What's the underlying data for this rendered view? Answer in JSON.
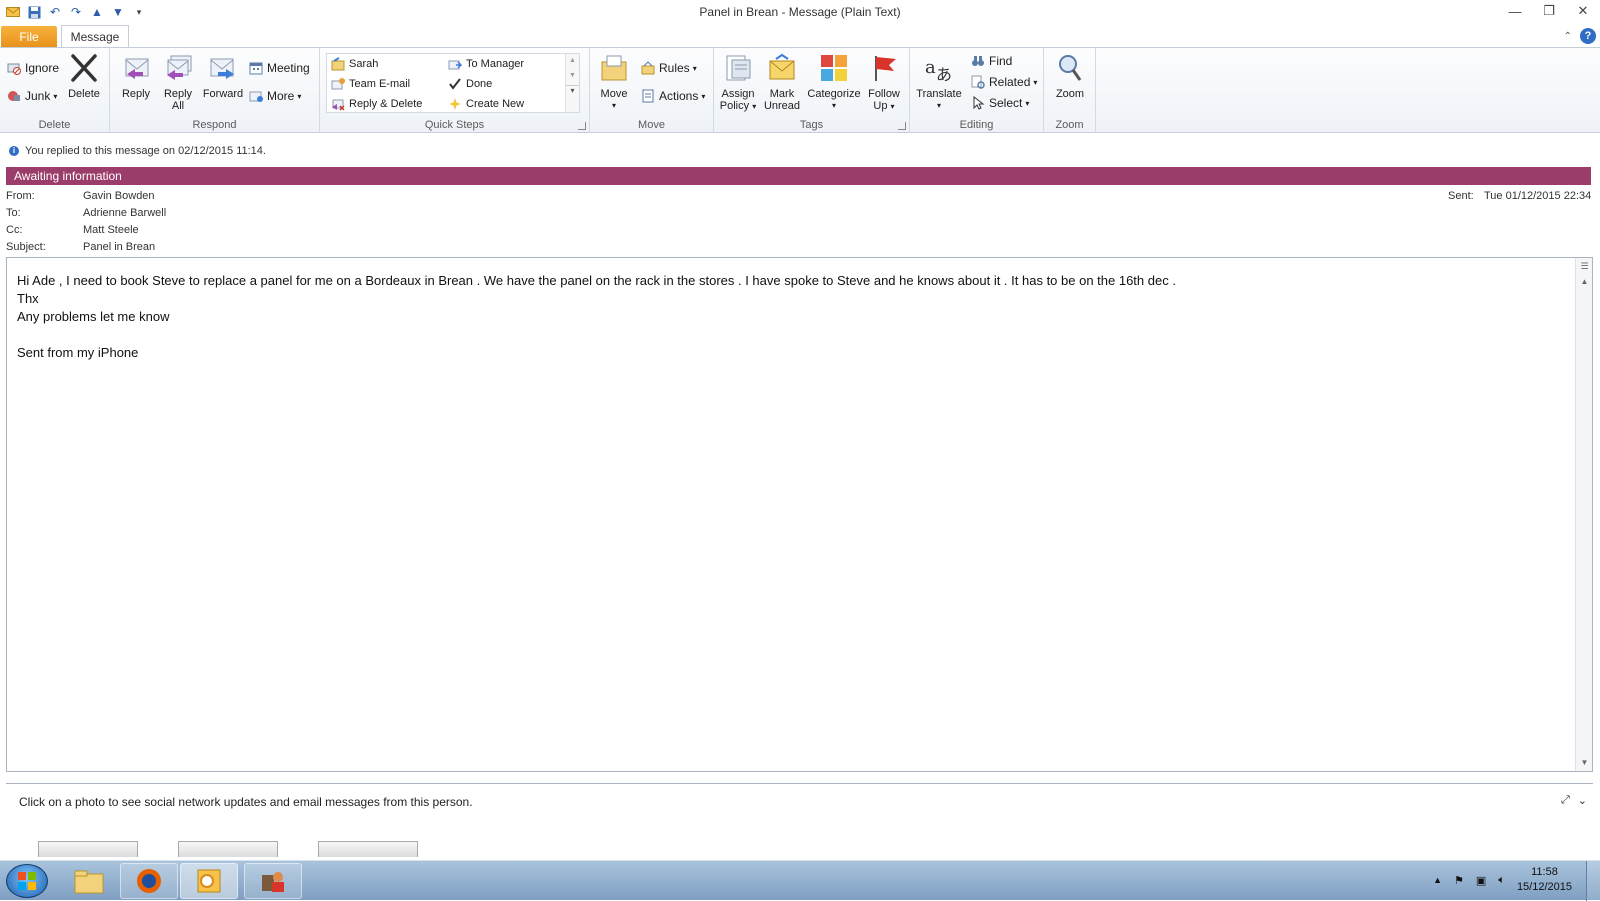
{
  "window": {
    "title": "Panel in Brean  - Message (Plain Text)"
  },
  "tabs": {
    "file": "File",
    "message": "Message"
  },
  "ribbon": {
    "delete": {
      "label": "Delete",
      "ignore": "Ignore",
      "junk": "Junk",
      "delete_btn": "Delete"
    },
    "respond": {
      "label": "Respond",
      "reply": "Reply",
      "reply_all_1": "Reply",
      "reply_all_2": "All",
      "forward": "Forward",
      "meeting": "Meeting",
      "more": "More"
    },
    "quicksteps": {
      "label": "Quick Steps",
      "items": [
        "Sarah",
        "Team E-mail",
        "Reply & Delete",
        "To Manager",
        "Done",
        "Create New"
      ]
    },
    "move": {
      "label": "Move",
      "move": "Move",
      "rules": "Rules",
      "actions": "Actions"
    },
    "tags": {
      "label": "Tags",
      "assign_1": "Assign",
      "assign_2": "Policy",
      "mark_1": "Mark",
      "mark_2": "Unread",
      "categorize": "Categorize",
      "follow_1": "Follow",
      "follow_2": "Up"
    },
    "editing": {
      "label": "Editing",
      "translate": "Translate",
      "find": "Find",
      "related": "Related",
      "select": "Select"
    },
    "zoom": {
      "label": "Zoom",
      "zoom": "Zoom"
    }
  },
  "infobar": {
    "text": "You replied to this message on 02/12/2015 11:14."
  },
  "category": {
    "text": "Awaiting information",
    "color": "#9b3d6a"
  },
  "header": {
    "from_label": "From:",
    "from": "Gavin Bowden",
    "to_label": "To:",
    "to": "Adrienne Barwell",
    "cc_label": "Cc:",
    "cc": "Matt Steele",
    "subject_label": "Subject:",
    "subject": "Panel in Brean",
    "sent_label": "Sent:",
    "sent": "Tue 01/12/2015 22:34"
  },
  "body": {
    "text": "Hi Ade , I need to book Steve to replace a panel for me on a Bordeaux in Brean . We have the panel on the rack in the stores . I have spoke to Steve and he knows about it . It has to be on the 16th dec .\nThx\nAny problems let me know\n\nSent from my iPhone"
  },
  "people_pane": {
    "text": "Click on a photo to see social network updates and email messages from this person."
  },
  "taskbar": {
    "time": "11:58",
    "date": "15/12/2015"
  },
  "colors": {
    "accent": "#2f6ec4",
    "file_tab": "#e8911c"
  }
}
